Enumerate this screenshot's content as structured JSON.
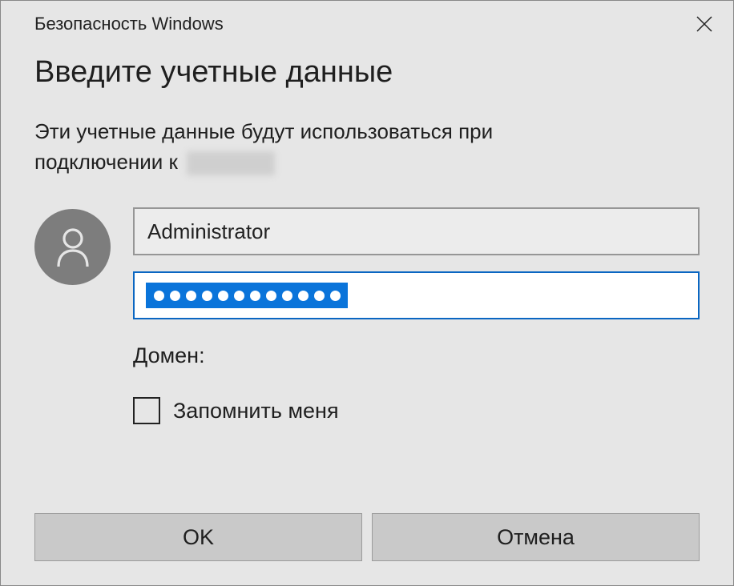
{
  "titlebar": {
    "title": "Безопасность Windows"
  },
  "dialog": {
    "heading": "Введите учетные данные",
    "subtext_line1": "Эти учетные данные будут использоваться при",
    "subtext_line2_prefix": "подключении к"
  },
  "credentials": {
    "username": "Administrator",
    "password_dots": 12,
    "domain_label": "Домен:",
    "remember_label": "Запомнить меня"
  },
  "buttons": {
    "ok": "OK",
    "cancel": "Отмена"
  },
  "icons": {
    "close": "close-icon",
    "user": "user-icon"
  }
}
